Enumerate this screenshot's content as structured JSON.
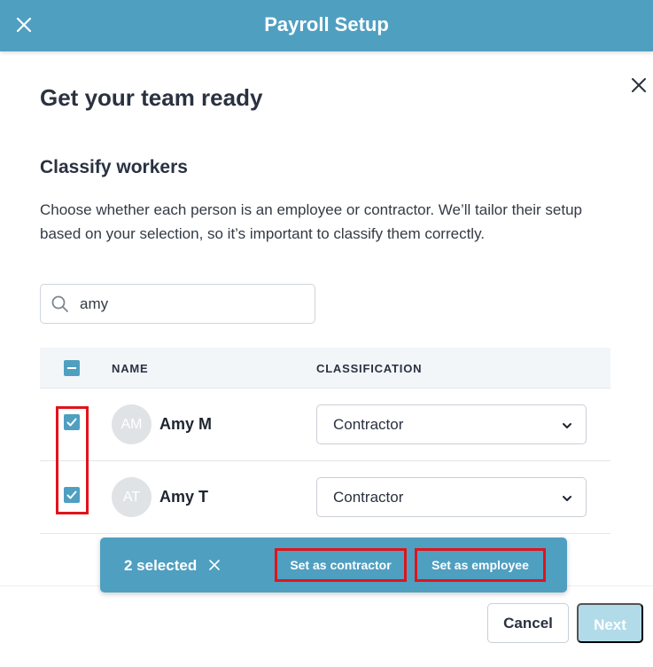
{
  "header": {
    "title": "Payroll Setup"
  },
  "page": {
    "title": "Get your team ready",
    "section_title": "Classify workers",
    "description": "Choose whether each person is an employee or contractor. We’ll tailor their setup based on your selection, so it’s important to classify them correctly."
  },
  "search": {
    "value": "amy"
  },
  "table": {
    "columns": {
      "name": "NAME",
      "classification": "CLASSIFICATION"
    },
    "rows": [
      {
        "initials": "AM",
        "name": "Amy M",
        "classification": "Contractor",
        "selected": true
      },
      {
        "initials": "AT",
        "name": "Amy T",
        "classification": "Contractor",
        "selected": true
      }
    ]
  },
  "bulk_bar": {
    "count_label": "2 selected",
    "set_contractor_label": "Set as contractor",
    "set_employee_label": "Set as employee"
  },
  "footer": {
    "cancel_label": "Cancel",
    "next_label": "Next"
  },
  "colors": {
    "brand": "#4f9fc1",
    "highlight": "#e0141b",
    "next_disabled": "#b2dbea"
  },
  "icons": {
    "header_close": "close-icon",
    "panel_close": "close-icon",
    "search": "search-icon",
    "checkbox": "check-icon",
    "select": "chevron-down-icon"
  }
}
